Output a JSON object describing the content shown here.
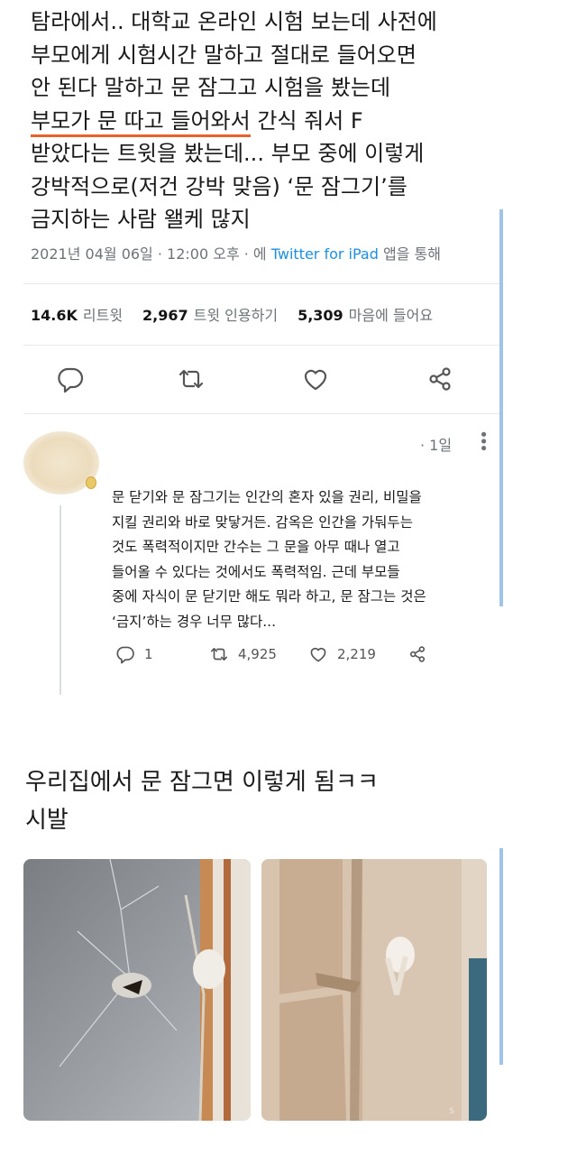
{
  "tweet": {
    "lines": [
      "탐라에서.. 대학교 온라인 시험 보는데 사전에",
      "부모에게 시험시간 말하고 절대로 들어오면",
      "안 된다 말하고 문 잠그고 시험을 봤는데",
      "부모가 문 따고 들어와서",
      " 간식 줘서 F",
      "받았다는 트윗을 봤는데... 부모 중에 이렇게",
      "강박적으로(저건 강박 맞음) ‘문 잠그기’를",
      "금지하는 사람 왤케 많지"
    ],
    "meta_prefix": "2021년 04월 06일 · 12:00 오후 · 에 ",
    "meta_app": "Twitter for iPad",
    "meta_suffix": " 앱을 통해",
    "stats": {
      "retweets_count": "14.6K",
      "retweets_label": "리트윗",
      "quotes_count": "2,967",
      "quotes_label": "트윗 인용하기",
      "likes_count": "5,309",
      "likes_label": "마음에 들어요"
    },
    "actions": [
      "reply-icon",
      "retweet-icon",
      "like-icon",
      "share-icon"
    ]
  },
  "reply": {
    "time": "· 1일",
    "lines": [
      "문 닫기와 문 잠그기는 인간의 혼자 있을 권리, 비밀을",
      "지킬 권리와 바로 맞닿거든. 감옥은 인간을 가둬두는",
      "것도 폭력적이지만 간수는 그 문을 아무 때나 열고",
      "들어올 수 있다는 것에서도 폭력적임. 근데 부모들",
      "중에 자식이 문 닫기만 해도 뭐라 하고, 문 잠그는 것은",
      "‘금지’하는 경우 너무 많다..."
    ],
    "reply_count": "1",
    "retweet_count": "4,925",
    "like_count": "2,219"
  },
  "caption": {
    "lines": [
      "우리집에서 문 잠그면 이렇게 됨ㅋㅋ",
      "시발"
    ]
  },
  "colors": {
    "accent": "#1d8fe0",
    "underline": "#e8622a",
    "scrollbar": "#9fc4e8"
  }
}
